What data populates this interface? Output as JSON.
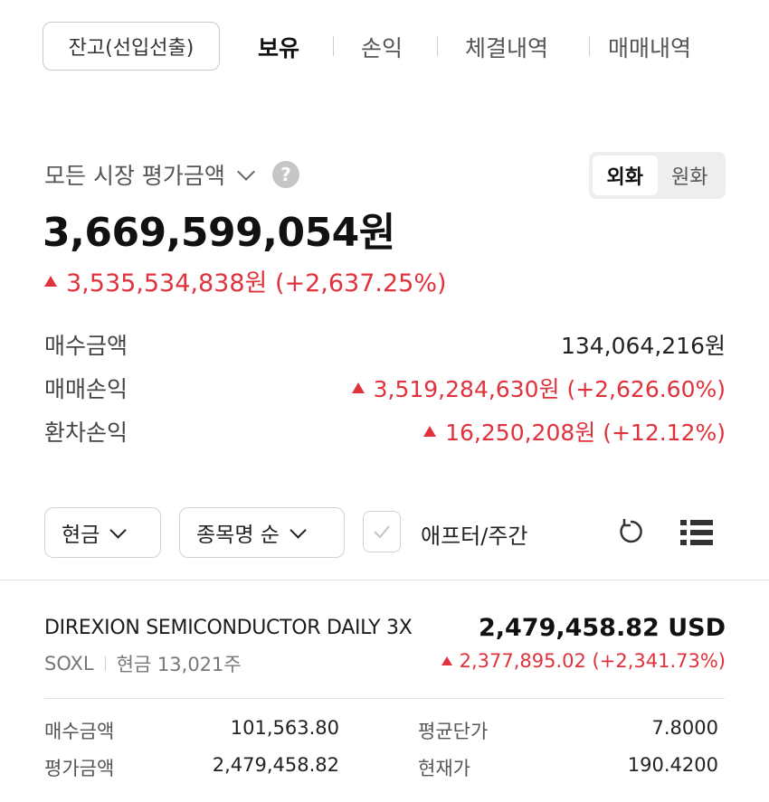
{
  "nav": {
    "balance_button": "잔고(선입선출)",
    "tabs": [
      "보유",
      "손익",
      "체결내역",
      "매매내역"
    ],
    "active_tab": "보유"
  },
  "summary": {
    "label": "모든 시장 평가금액",
    "currency_toggle": [
      "외화",
      "원화"
    ],
    "selected_currency": "외화",
    "total": "3,669,599,054원",
    "gain": "3,535,534,838원 (+2,637.25%)",
    "rows": [
      {
        "label": "매수금액",
        "value": "134,064,216원",
        "trend": "none"
      },
      {
        "label": "매매손익",
        "value": "3,519,284,630원 (+2,626.60%)",
        "trend": "up"
      },
      {
        "label": "환차손익",
        "value": "16,250,208원 (+12.12%)",
        "trend": "up"
      }
    ]
  },
  "filters": {
    "type_select": "현금",
    "sort_select": "종목명 순",
    "after_hours_label": "애프터/주간"
  },
  "holdings": [
    {
      "name": "DIREXION SEMICONDUCTOR DAILY 3X",
      "value": "2,479,458.82 USD",
      "ticker": "SOXL",
      "position": "현금 13,021주",
      "gain": "2,377,895.02 (+2,341.73%)",
      "details": {
        "buy_amount_label": "매수금액",
        "buy_amount": "101,563.80",
        "eval_amount_label": "평가금액",
        "eval_amount": "2,479,458.82",
        "avg_price_label": "평균단가",
        "avg_price": "7.8000",
        "current_price_label": "현재가",
        "current_price": "190.4200"
      }
    }
  ],
  "colors": {
    "up": "#e0323c",
    "text": "#1f1f1f",
    "muted": "#777777"
  }
}
